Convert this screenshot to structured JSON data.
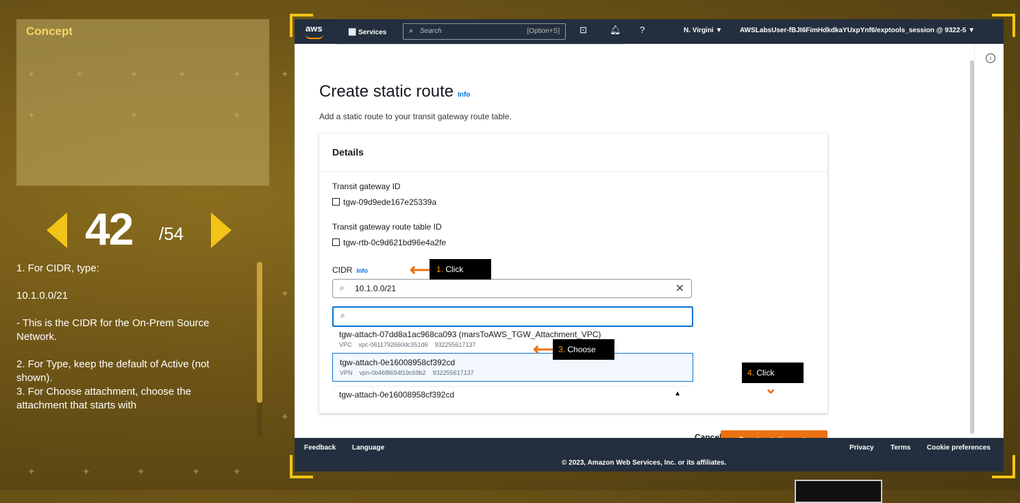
{
  "sidebar": {
    "concept_title": "Concept",
    "page_current": "42",
    "page_total": "/54",
    "instructions": [
      "1. For CIDR, type:",
      "10.1.0.0/21",
      "- This is the CIDR for the On-Prem Source Network.",
      "2. For Type, keep the default of Active (not shown).",
      "3. For Choose attachment, choose the attachment that starts with"
    ]
  },
  "topnav": {
    "logo": "aws",
    "services": "Services",
    "search_placeholder": "Search",
    "search_shortcut": "[Option+S]",
    "region": "N. Virgini ▼",
    "account": "AWSLabsUser-fBJI6FimHdkdkaYUxpYnf6/exptools_session @ 9322-5 ▼"
  },
  "page": {
    "title": "Create static route",
    "info": "Info",
    "subtitle": "Add a static route to your transit gateway route table.",
    "details_title": "Details",
    "tgw_label": "Transit gateway ID",
    "tgw_value": "tgw-09d9ede167e25339a",
    "rtb_label": "Transit gateway route table ID",
    "rtb_value": "tgw-rtb-0c9d621bd96e4a2fe",
    "cidr_label": "CIDR",
    "cidr_info": "Info",
    "cidr_value": "10.1.0.0/21",
    "options": [
      {
        "name": "tgw-attach-07dd8a1ac968ca093 (marsToAWS_TGW_Attachment_VPC)",
        "type": "VPC",
        "resource": "vpc-0611792660dc351d6",
        "account": "932255617137"
      },
      {
        "name": "tgw-attach-0e16008958cf392cd",
        "type": "VPN",
        "resource": "vpn-0b46f8694f19c69b2",
        "account": "932255617137"
      }
    ],
    "selected_attachment": "tgw-attach-0e16008958cf392cd",
    "cancel": "Cancel",
    "create": "Create static route"
  },
  "callouts": {
    "c1_num": "1.",
    "c1_text": " Click",
    "c3_num": "3.",
    "c3_text": " Choose",
    "c4_num": "4.",
    "c4_text": " Click"
  },
  "footer": {
    "feedback": "Feedback",
    "language": "Language",
    "privacy": "Privacy",
    "terms": "Terms",
    "cookies": "Cookie preferences",
    "copyright": "© 2023, Amazon Web Services, Inc. or its affiliates."
  }
}
